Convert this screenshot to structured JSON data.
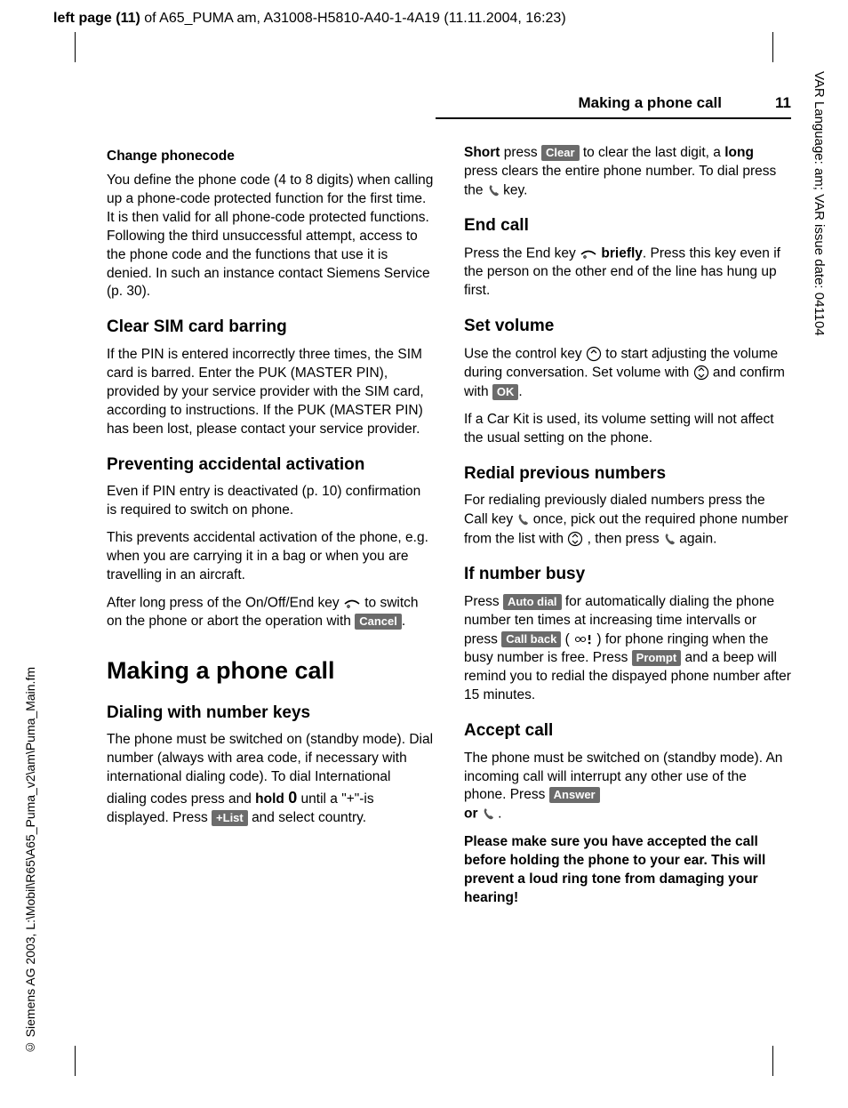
{
  "meta": {
    "top_header_bold": "left page (11)",
    "top_header_rest": " of A65_PUMA am, A31008-H5810-A40-1-4A19 (11.11.2004, 16:23)",
    "side_left": "© Siemens AG 2003, L:\\Mobil\\R65\\A65_Puma_v2\\am\\Puma_Main.fm",
    "side_right": "VAR Language: am; VAR issue date: 041104",
    "running_title": "Making a phone call",
    "page_number": "11"
  },
  "left": {
    "h_change": "Change phonecode",
    "p_change": "You define the phone code (4 to 8 digits) when calling up a phone-code protected function for the first time. It is then valid for all phone-code protected functions. Following the third unsuccessful attempt, access to the phone code and the functions that use it is denied. In such an instance contact Siemens Service (p. 30).",
    "h_clear": "Clear SIM card barring",
    "p_clear": "If the PIN is entered incorrectly three times, the SIM card is barred. Enter the PUK (MASTER PIN), provided by your service provider with the SIM card, according to instructions. If the PUK (MASTER PIN) has been lost, please contact your service provider.",
    "h_prevent": "Preventing accidental activation",
    "p_prevent1": "Even if PIN entry is deactivated (p. 10) confirmation is required to switch on phone.",
    "p_prevent2": "This prevents accidental activation of the phone, e.g. when you are carrying it in a bag or when you are travelling in an aircraft.",
    "p_prevent3a": "After long press of the On/Off/End key ",
    "p_prevent3b": " to switch on the phone or abort the operation with ",
    "key_cancel": "Cancel",
    "h_making": "Making a phone call",
    "h_dial": "Dialing with number keys",
    "p_dial1a": "The phone must be switched on (standby mode). Dial number (always with area code, if necessary with international dialing code). To dial International dialing codes press and ",
    "p_dial1_hold": "hold ",
    "digit0": "0",
    "p_dial1b": " until a \"+\"-is displayed. Press ",
    "key_list": "+List",
    "p_dial1c": " and select country."
  },
  "right": {
    "p_short_a": "Short",
    "p_short_b": " press ",
    "key_clear": "Clear",
    "p_short_c": " to clear the last digit, a ",
    "p_short_long": "long",
    "p_short_d": " press clears the entire phone number. To dial press the ",
    "p_short_e": " key.",
    "h_end": "End call",
    "p_end_a": "Press the End key ",
    "p_end_briefly": " briefly",
    "p_end_b": ". Press this key even if the person on the other end of the line has hung up first.",
    "h_vol": "Set volume",
    "p_vol_a": "Use the control key ",
    "p_vol_b": " to start adjusting the volume during conversation. Set volume with ",
    "p_vol_c": " and confirm with ",
    "key_ok": "OK",
    "p_vol_d": ".",
    "p_vol2": "If a Car Kit is used, its volume setting will not affect the usual setting on the phone.",
    "h_redial": "Redial previous numbers",
    "p_redial_a": "For redialing previously dialed numbers press the Call key ",
    "p_redial_b": " once, pick out the required phone number from the list with ",
    "p_redial_c": " , then press ",
    "p_redial_d": " again.",
    "h_busy": "If number busy",
    "p_busy_a": "Press ",
    "key_auto": "Auto dial",
    "p_busy_b": " for automatically dialing the phone number ten times at increasing time intervalls or press ",
    "key_callback": "Call back",
    "p_busy_c": " ( ",
    "p_busy_d": ") for phone ringing when the busy number is free. Press ",
    "key_prompt": "Prompt",
    "p_busy_e": " and a beep will remind you to redial the dispayed phone number after 15 minutes.",
    "h_accept": "Accept call",
    "p_accept_a": "The phone must be switched on (standby mode). An incoming call will interrupt any other use of the phone. Press ",
    "key_answer": "Answer",
    "p_accept_b": "or ",
    "p_accept_c": " .",
    "p_warn": "Please make sure you have accepted the call before holding the phone to your ear. This will prevent a loud ring tone from damaging your hearing!"
  }
}
